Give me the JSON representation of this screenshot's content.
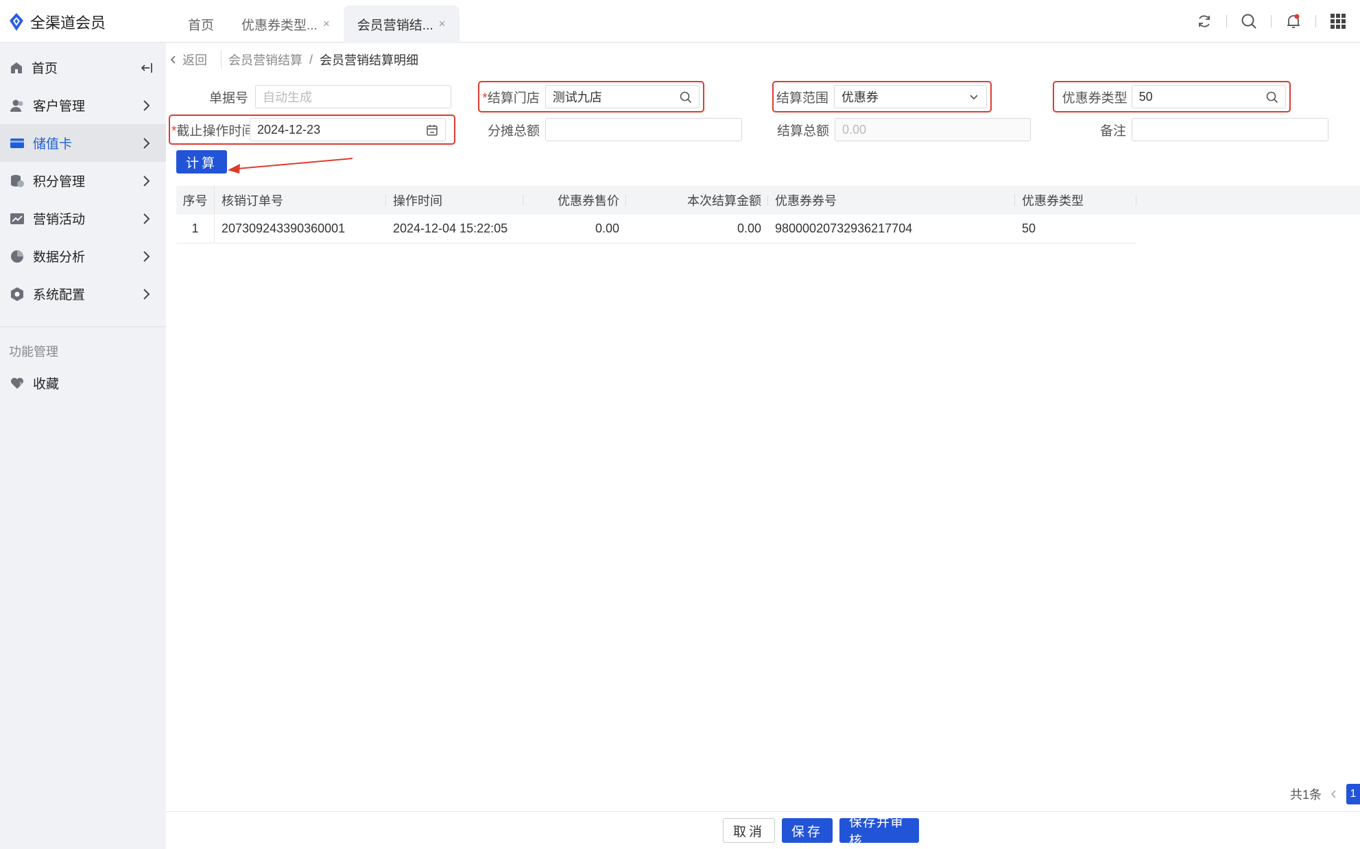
{
  "app": {
    "title": "全渠道会员"
  },
  "tabs": [
    {
      "label": "首页",
      "closable": false
    },
    {
      "label": "优惠券类型...",
      "closable": true
    },
    {
      "label": "会员营销结...",
      "closable": true,
      "active": true
    }
  ],
  "tab_close": "×",
  "sidebar": {
    "items": [
      {
        "label": "首页",
        "icon": "home-icon"
      },
      {
        "label": "客户管理",
        "icon": "customer-icon"
      },
      {
        "label": "储值卡",
        "icon": "card-icon",
        "active": true
      },
      {
        "label": "积分管理",
        "icon": "points-icon"
      },
      {
        "label": "营销活动",
        "icon": "chart-icon"
      },
      {
        "label": "数据分析",
        "icon": "pie-icon"
      },
      {
        "label": "系统配置",
        "icon": "settings-icon"
      }
    ],
    "section_title": "功能管理",
    "favorites": {
      "label": "收藏",
      "icon": "heart-icon"
    }
  },
  "breadcrumb": {
    "back": "返回",
    "parent": "会员营销结算",
    "separator": "/",
    "current": "会员营销结算明细"
  },
  "form": {
    "doc_no": {
      "label": "单据号",
      "placeholder": "自动生成",
      "value": ""
    },
    "store": {
      "label": "结算门店",
      "required": true,
      "value": "测试九店"
    },
    "scope": {
      "label": "结算范围",
      "value": "优惠券"
    },
    "coupon_type": {
      "label": "优惠券类型",
      "value": "50"
    },
    "cutoff": {
      "label": "截止操作时间",
      "required": true,
      "value": "2024-12-23"
    },
    "allocated_total": {
      "label": "分摊总额",
      "value": ""
    },
    "settle_total": {
      "label": "结算总额",
      "placeholder": "0.00",
      "value": ""
    },
    "remark": {
      "label": "备注",
      "value": ""
    },
    "required_mark": "*"
  },
  "calc_button": "计算",
  "table": {
    "headers": [
      "序号",
      "核销订单号",
      "操作时间",
      "优惠券售价",
      "本次结算金额",
      "优惠券券号",
      "优惠券类型"
    ],
    "rows": [
      [
        "1",
        "207309243390360001",
        "2024-12-04 15:22:05",
        "0.00",
        "0.00",
        "98000020732936217704",
        "50"
      ]
    ]
  },
  "pagination": {
    "total": "共1条",
    "current_page": "1"
  },
  "footer": {
    "cancel": "取消",
    "save": "保存",
    "save_audit": "保存并审核"
  },
  "colors": {
    "primary": "#2254d8",
    "highlight": "#e03a2e",
    "active_nav": "#1f5fd6"
  }
}
